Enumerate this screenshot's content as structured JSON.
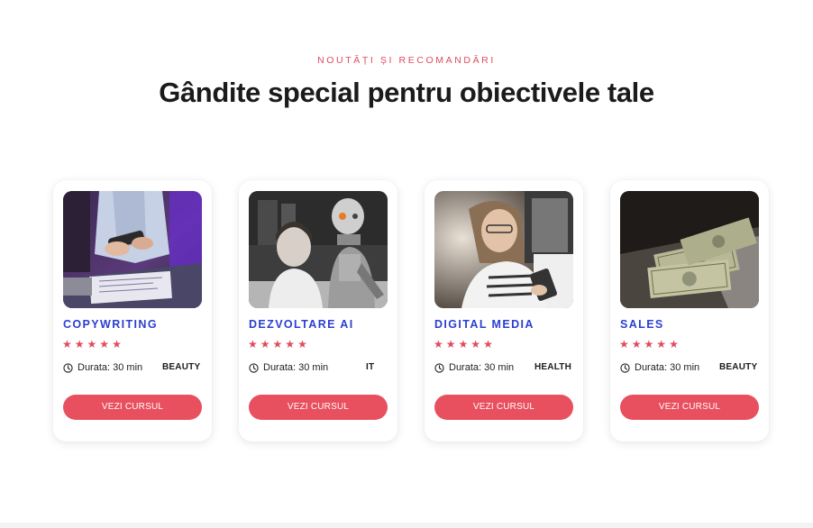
{
  "section": {
    "eyebrow": "NOUTĂȚI ȘI RECOMANDĂRI",
    "headline": "Gândite special pentru obiectivele tale"
  },
  "colors": {
    "accent": "#e8505f",
    "title_blue": "#2a3fd1",
    "eyebrow": "#e14b5e"
  },
  "cards": [
    {
      "title": "COPYWRITING",
      "rating": 5,
      "duration": "Durata: 30 min",
      "tag": "BEAUTY",
      "button": "VEZI CURSUL",
      "image_icon": "photo-person-writing-icon"
    },
    {
      "title": "DEZVOLTARE AI",
      "rating": 5,
      "duration": "Durata: 30 min",
      "tag": "IT",
      "button": "VEZI CURSUL",
      "image_icon": "photo-robot-and-woman-icon"
    },
    {
      "title": "DIGITAL MEDIA",
      "rating": 5,
      "duration": "Durata: 30 min",
      "tag": "HEALTH",
      "button": "VEZI CURSUL",
      "image_icon": "photo-woman-phone-icon"
    },
    {
      "title": "SALES",
      "rating": 5,
      "duration": "Durata: 30 min",
      "tag": "BEAUTY",
      "button": "VEZI CURSUL",
      "image_icon": "photo-money-laptop-icon"
    }
  ],
  "icons": {
    "star": "star-icon",
    "clock": "clock-icon"
  }
}
